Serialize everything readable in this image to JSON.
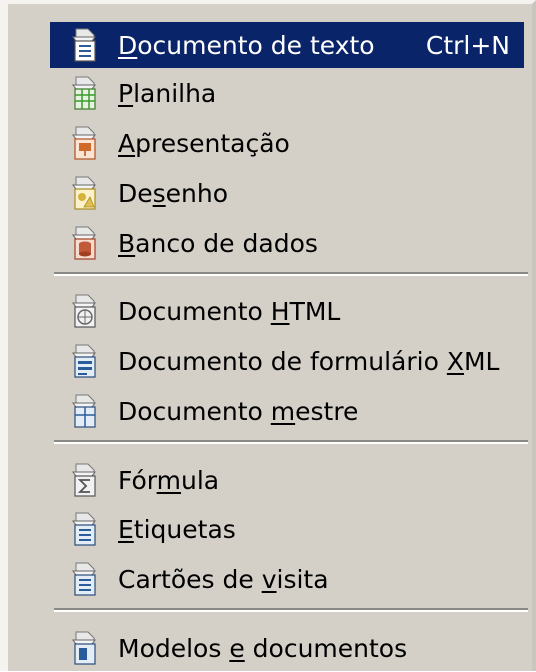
{
  "menu": {
    "items": [
      {
        "label_pre": "",
        "label_acc": "D",
        "label_post": "ocumento de texto",
        "shortcut": "Ctrl+N",
        "icon": "text-document-icon",
        "accent": "#2a5c9a",
        "selected": true
      },
      {
        "label_pre": "",
        "label_acc": "P",
        "label_post": "lanilha",
        "shortcut": "",
        "icon": "spreadsheet-icon",
        "accent": "#3a9a2a"
      },
      {
        "label_pre": "",
        "label_acc": "A",
        "label_post": "presentação",
        "shortcut": "",
        "icon": "presentation-icon",
        "accent": "#d06a2a"
      },
      {
        "label_pre": "De",
        "label_acc": "s",
        "label_post": "enho",
        "shortcut": "",
        "icon": "drawing-icon",
        "accent": "#d6b23a"
      },
      {
        "label_pre": "",
        "label_acc": "B",
        "label_post": "anco de dados",
        "shortcut": "",
        "icon": "database-icon",
        "accent": "#c05a3a"
      },
      {
        "label_pre": "Documento ",
        "label_acc": "H",
        "label_post": "TML",
        "shortcut": "",
        "icon": "html-document-icon",
        "accent": "#6a6a6a"
      },
      {
        "label_pre": "Documento de formulário ",
        "label_acc": "X",
        "label_post": "ML",
        "shortcut": "",
        "icon": "xml-form-document-icon",
        "accent": "#2a5c9a"
      },
      {
        "label_pre": "Documento ",
        "label_acc": "m",
        "label_post": "estre",
        "shortcut": "",
        "icon": "master-document-icon",
        "accent": "#2a5c9a"
      },
      {
        "label_pre": "Fór",
        "label_acc": "m",
        "label_post": "ula",
        "shortcut": "",
        "icon": "formula-icon",
        "accent": "#6a6a6a"
      },
      {
        "label_pre": "",
        "label_acc": "E",
        "label_post": "tiquetas",
        "shortcut": "",
        "icon": "labels-icon",
        "accent": "#2a5c9a"
      },
      {
        "label_pre": "Cartões de ",
        "label_acc": "v",
        "label_post": "isita",
        "shortcut": "",
        "icon": "business-cards-icon",
        "accent": "#2a5c9a"
      },
      {
        "label_pre": "Modelos ",
        "label_acc": "e",
        "label_post": " documentos",
        "shortcut": "",
        "icon": "templates-icon",
        "accent": "#2a5c9a"
      }
    ]
  }
}
